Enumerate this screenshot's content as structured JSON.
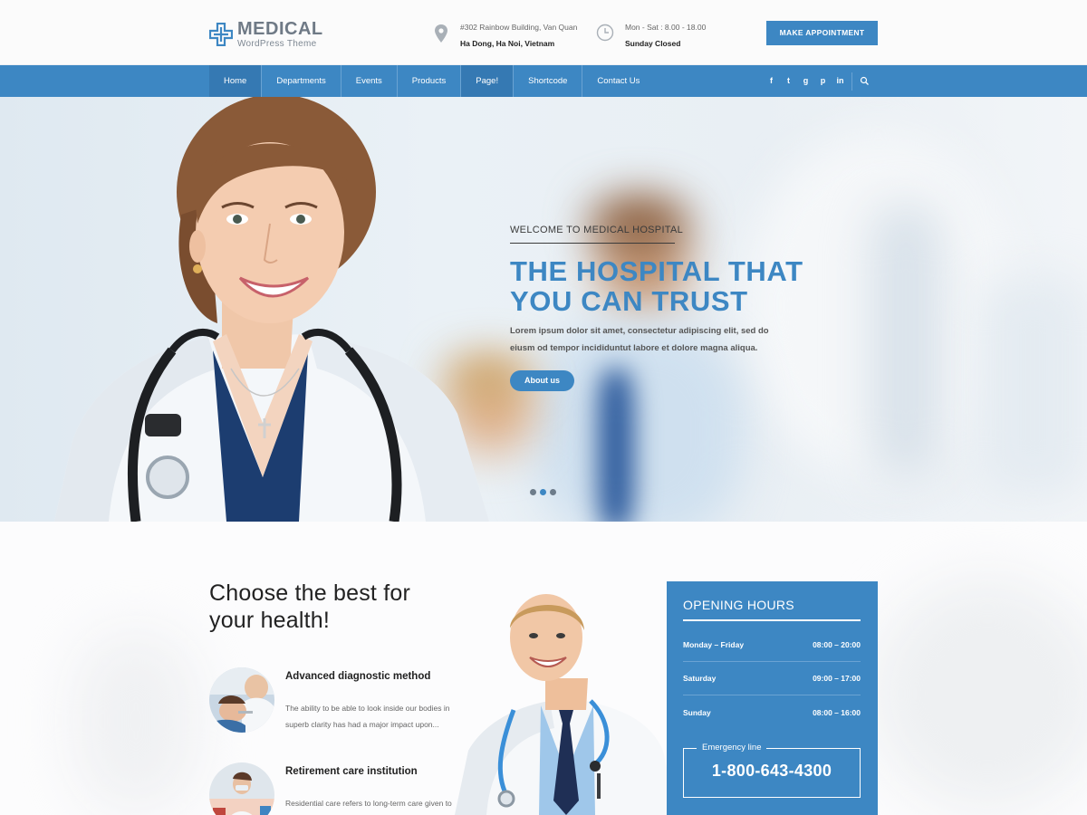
{
  "brand": {
    "title": "MEDICAL",
    "subtitle": "WordPress Theme",
    "color": "#3d87c3"
  },
  "header": {
    "address_line1": "#302 Rainbow Building, Van Quan",
    "address_line2": "Ha Dong, Ha Noi, Vietnam",
    "hours_line1": "Mon - Sat : 8.00 - 18.00",
    "hours_line2": "Sunday Closed",
    "appointment_label": "MAKE APPOINTMENT",
    "icons": {
      "address": "map-pin-icon",
      "hours": "clock-icon"
    }
  },
  "nav": {
    "items": [
      {
        "label": "Home"
      },
      {
        "label": "Departments"
      },
      {
        "label": "Events"
      },
      {
        "label": "Products"
      },
      {
        "label": "Page!"
      },
      {
        "label": "Shortcode"
      },
      {
        "label": "Contact Us"
      }
    ],
    "social": [
      {
        "glyph": "f",
        "name": "facebook-icon"
      },
      {
        "glyph": "t",
        "name": "twitter-icon"
      },
      {
        "glyph": "g",
        "name": "google-plus-icon"
      },
      {
        "glyph": "p",
        "name": "pinterest-icon"
      },
      {
        "glyph": "in",
        "name": "linkedin-icon"
      }
    ]
  },
  "hero": {
    "welcome": "WELCOME TO MEDICAL HOSPITAL",
    "title_line1": "THE HOSPITAL THAT",
    "title_line2": "YOU CAN TRUST",
    "desc": "Lorem ipsum dolor sit amet, consectetur adipiscing elit, sed do eiusm od tempor incididuntut labore et dolore magna aliqua.",
    "button": "About us",
    "slides_total": 3,
    "slide_active": 1
  },
  "section": {
    "title_line1": "Choose the best for",
    "title_line2": "your health!",
    "features": [
      {
        "title": "Advanced diagnostic method",
        "desc": "The ability to be able to look inside our bodies in superb clarity has had a major impact upon..."
      },
      {
        "title": "Retirement care institution",
        "desc": "Residential care refers to long-term care given to"
      }
    ]
  },
  "opening_hours": {
    "title": "OPENING HOURS",
    "rows": [
      {
        "day": "Monday – Friday",
        "time": "08:00 – 20:00"
      },
      {
        "day": "Saturday",
        "time": "09:00 – 17:00"
      },
      {
        "day": "Sunday",
        "time": "08:00 – 16:00"
      }
    ],
    "emergency_label": "Emergency line",
    "emergency_phone": "1-800-643-4300"
  }
}
